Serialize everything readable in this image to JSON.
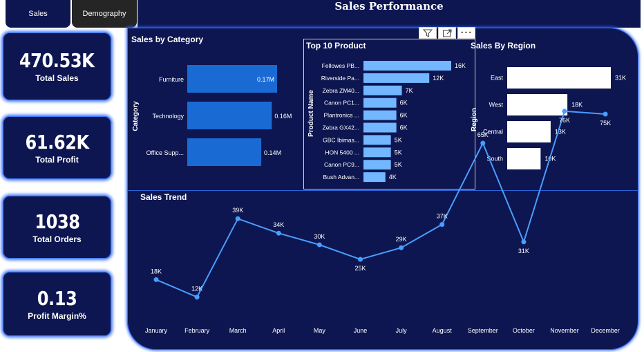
{
  "header": {
    "title": "Sales Performance"
  },
  "tabs": [
    {
      "label": "Sales"
    },
    {
      "label": "Demography"
    }
  ],
  "toolbar": {
    "filter_icon": "filter-icon",
    "focus_icon": "focus-mode-icon",
    "more_icon": "more-options-icon",
    "more_label": "•••"
  },
  "kpis": [
    {
      "value": "470.53K",
      "label": "Total Sales"
    },
    {
      "value": "61.62K",
      "label": "Total Profit"
    },
    {
      "value": "1038",
      "label": "Total Orders"
    },
    {
      "value": "0.13",
      "label": "Profit Margin%"
    }
  ],
  "colors": {
    "background": "#0d1650",
    "category_bar": "#1a6ad4",
    "product_bar": "#72b7ff",
    "region_bar": "#ffffff",
    "trend_line": "#4a9dff",
    "accent_glow": "#3b72ff"
  },
  "sections": {
    "category_title": "Sales by Category",
    "product_title": "Top 10 Product",
    "region_title": "Sales By Region",
    "trend_title": "Sales Trend"
  },
  "chart_data": [
    {
      "type": "bar",
      "title": "Sales by Category",
      "orientation": "horizontal",
      "ylabel": "Category",
      "categories": [
        "Furniture",
        "Technology",
        "Office Supp..."
      ],
      "values": [
        0.17,
        0.16,
        0.14
      ],
      "data_labels": [
        "0.17M",
        "0.16M",
        "0.14M"
      ],
      "unit": "M",
      "grid": false
    },
    {
      "type": "bar",
      "title": "Top 10 Product",
      "orientation": "horizontal",
      "ylabel": "Product Name",
      "categories": [
        "Fellowes PB...",
        "Riverside Pa...",
        "Zebra ZM40...",
        "Canon PC1...",
        "Plantronics ...",
        "Zebra GX42...",
        "GBC Ibimas...",
        "HON 5400 ...",
        "Canon PC9...",
        "Bush Advan..."
      ],
      "values": [
        16,
        12,
        7,
        6,
        6,
        6,
        5,
        5,
        5,
        4
      ],
      "data_labels": [
        "16K",
        "12K",
        "7K",
        "6K",
        "6K",
        "6K",
        "5K",
        "5K",
        "5K",
        "4K"
      ],
      "unit": "K",
      "grid": false
    },
    {
      "type": "bar",
      "title": "Sales By Region",
      "orientation": "horizontal",
      "ylabel": "Region",
      "categories": [
        "East",
        "West",
        "Central",
        "South"
      ],
      "values": [
        31,
        18,
        13,
        10
      ],
      "data_labels": [
        "31K",
        "18K",
        "13K",
        "10K"
      ],
      "unit": "K",
      "grid": false
    },
    {
      "type": "line",
      "title": "Sales Trend",
      "x": [
        "January",
        "February",
        "March",
        "April",
        "May",
        "June",
        "July",
        "August",
        "September",
        "October",
        "November",
        "December"
      ],
      "values": [
        18,
        12,
        39,
        34,
        30,
        25,
        29,
        37,
        65,
        31,
        76,
        75
      ],
      "data_labels": [
        "18K",
        "12K",
        "39K",
        "34K",
        "30K",
        "25K",
        "29K",
        "37K",
        "65K",
        "31K",
        "76K",
        "75K"
      ],
      "unit": "K",
      "grid": false
    }
  ]
}
